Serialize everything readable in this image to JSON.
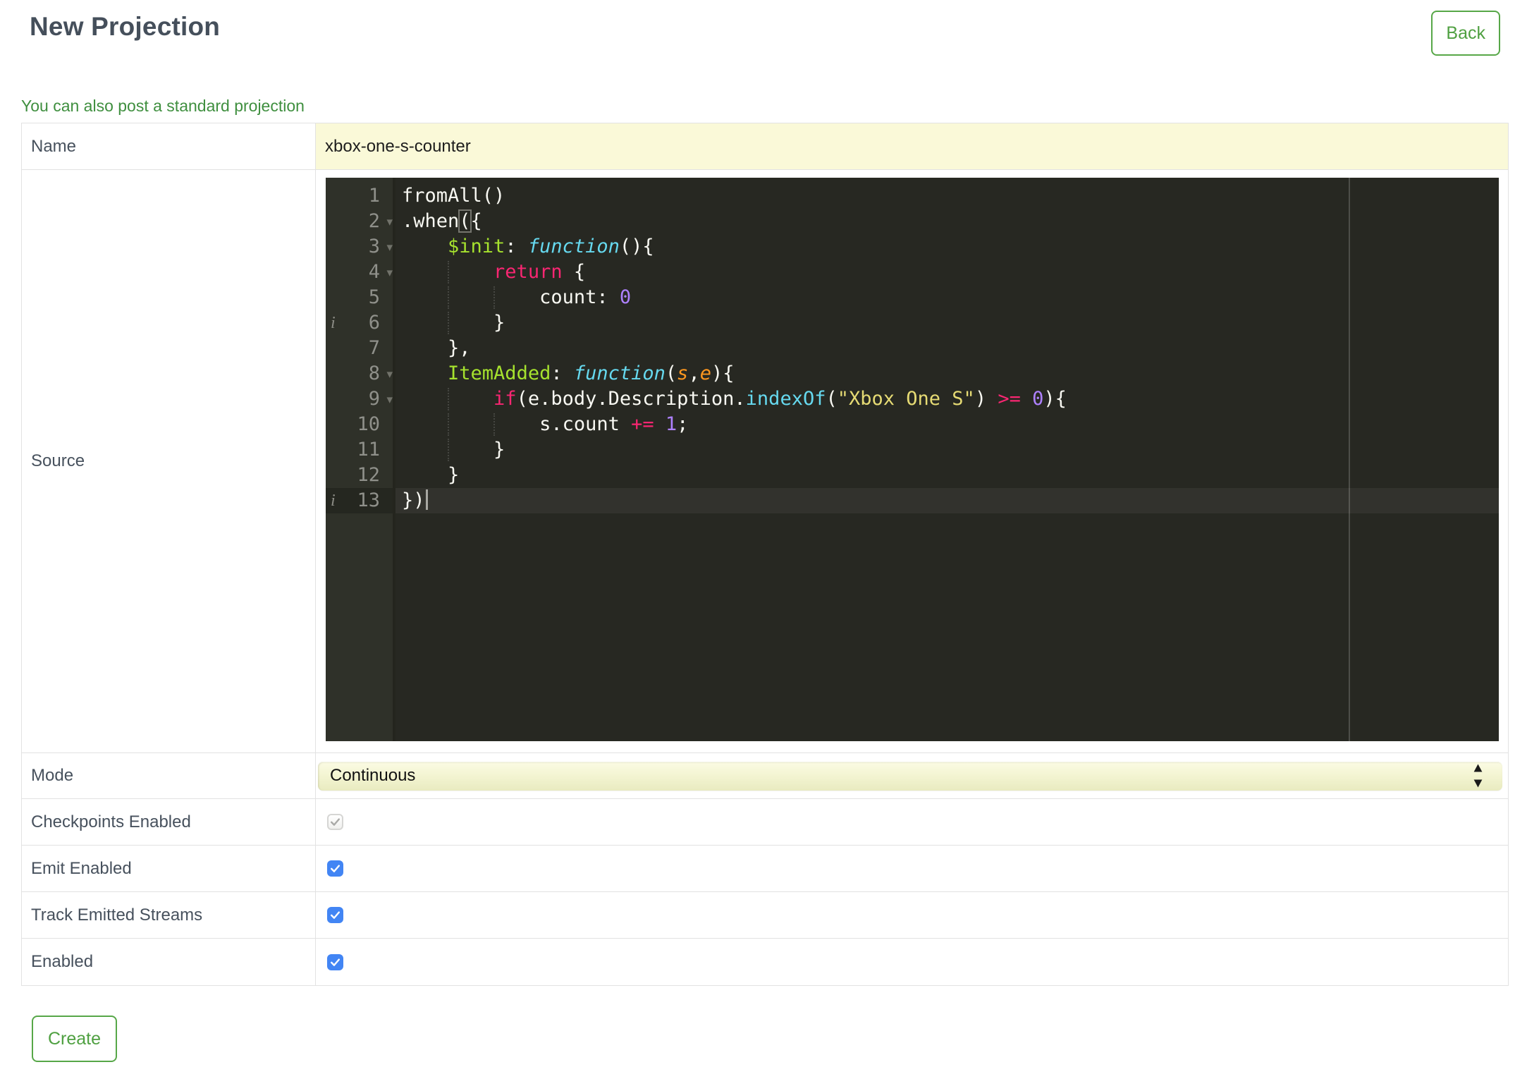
{
  "header": {
    "title": "New Projection",
    "back_label": "Back"
  },
  "standard_projection_link": "You can also post a standard projection",
  "form": {
    "name": {
      "label": "Name",
      "value": "xbox-one-s-counter"
    },
    "source": {
      "label": "Source"
    },
    "mode": {
      "label": "Mode",
      "value": "Continuous"
    },
    "checkboxes": [
      {
        "label": "Checkpoints Enabled",
        "checked": true,
        "disabled": true
      },
      {
        "label": "Emit Enabled",
        "checked": true,
        "disabled": false
      },
      {
        "label": "Track Emitted Streams",
        "checked": true,
        "disabled": false
      },
      {
        "label": "Enabled",
        "checked": true,
        "disabled": false
      }
    ],
    "create_label": "Create"
  },
  "colors": {
    "accent_green": "#4FA041",
    "green_border": "#57A748",
    "link_green": "#3F8F3F",
    "title_text": "#454F5B",
    "label_text": "#47515D",
    "table_border": "#E2E2E2",
    "field_yellow": "#FAF9D8",
    "select_yellow_top": "#FBFBE4",
    "select_yellow_bottom": "#E9EBC0",
    "checkbox_blue": "#4285F4"
  },
  "editor": {
    "theme": {
      "background": "#272822",
      "gutter_bg": "#2F3129",
      "gutter_edge": "#24251E",
      "gutter_text": "#8F908A",
      "text": "#F8F8F2",
      "keyword": "#F92672",
      "entity": "#A6E22E",
      "support": "#66D9EF",
      "string": "#E6DB74",
      "number": "#AE81FF",
      "param": "#FD971F",
      "active_code": "rgba(255,255,255,0.05)",
      "active_gutter": "rgba(0,0,0,0.2)",
      "guide": "rgba(255,255,255,0.14)",
      "print_margin": "rgba(255,255,255,0.18)",
      "cursor": "#A8A8A2"
    },
    "annotations": [
      6,
      13
    ],
    "folds": [
      2,
      3,
      4,
      8,
      9
    ],
    "active_line": 13,
    "cursor_line": 13,
    "lines": [
      {
        "n": 1,
        "guides": [],
        "segments": [
          {
            "t": "fromAll()",
            "c": "plain"
          }
        ]
      },
      {
        "n": 2,
        "guides": [],
        "segments": [
          {
            "t": ".when",
            "c": "plain"
          },
          {
            "t": "(",
            "c": "plain match"
          },
          {
            "t": "{",
            "c": "plain"
          }
        ]
      },
      {
        "n": 3,
        "guides": [],
        "segments": [
          {
            "t": "    ",
            "c": "plain"
          },
          {
            "t": "$init",
            "c": "entity"
          },
          {
            "t": ": ",
            "c": "plain"
          },
          {
            "t": "function",
            "c": "support"
          },
          {
            "t": "(){",
            "c": "plain"
          }
        ]
      },
      {
        "n": 4,
        "guides": [
          4
        ],
        "segments": [
          {
            "t": "        ",
            "c": "plain"
          },
          {
            "t": "return",
            "c": "keyword"
          },
          {
            "t": " {",
            "c": "plain"
          }
        ]
      },
      {
        "n": 5,
        "guides": [
          4,
          8
        ],
        "segments": [
          {
            "t": "            count: ",
            "c": "plain"
          },
          {
            "t": "0",
            "c": "number"
          }
        ]
      },
      {
        "n": 6,
        "guides": [
          4
        ],
        "segments": [
          {
            "t": "        }",
            "c": "plain"
          }
        ]
      },
      {
        "n": 7,
        "guides": [],
        "segments": [
          {
            "t": "    },",
            "c": "plain"
          }
        ]
      },
      {
        "n": 8,
        "guides": [],
        "segments": [
          {
            "t": "    ",
            "c": "plain"
          },
          {
            "t": "ItemAdded",
            "c": "entity"
          },
          {
            "t": ": ",
            "c": "plain"
          },
          {
            "t": "function",
            "c": "support"
          },
          {
            "t": "(",
            "c": "plain"
          },
          {
            "t": "s",
            "c": "param"
          },
          {
            "t": ",",
            "c": "plain"
          },
          {
            "t": "e",
            "c": "param"
          },
          {
            "t": "){",
            "c": "plain"
          }
        ]
      },
      {
        "n": 9,
        "guides": [
          4
        ],
        "segments": [
          {
            "t": "        ",
            "c": "plain"
          },
          {
            "t": "if",
            "c": "keyword"
          },
          {
            "t": "(e.body.Description.",
            "c": "plain"
          },
          {
            "t": "indexOf",
            "c": "supportfn"
          },
          {
            "t": "(",
            "c": "plain"
          },
          {
            "t": "\"Xbox One S\"",
            "c": "string"
          },
          {
            "t": ") ",
            "c": "plain"
          },
          {
            "t": ">=",
            "c": "keyword"
          },
          {
            "t": " ",
            "c": "plain"
          },
          {
            "t": "0",
            "c": "number"
          },
          {
            "t": "){",
            "c": "plain"
          }
        ]
      },
      {
        "n": 10,
        "guides": [
          4,
          8
        ],
        "segments": [
          {
            "t": "            s.count ",
            "c": "plain"
          },
          {
            "t": "+=",
            "c": "keyword"
          },
          {
            "t": " ",
            "c": "plain"
          },
          {
            "t": "1",
            "c": "number"
          },
          {
            "t": ";",
            "c": "plain"
          }
        ]
      },
      {
        "n": 11,
        "guides": [
          4
        ],
        "segments": [
          {
            "t": "        }",
            "c": "plain"
          }
        ]
      },
      {
        "n": 12,
        "guides": [],
        "segments": [
          {
            "t": "    }",
            "c": "plain"
          }
        ]
      },
      {
        "n": 13,
        "guides": [],
        "segments": [
          {
            "t": "})",
            "c": "plain"
          }
        ]
      }
    ]
  }
}
